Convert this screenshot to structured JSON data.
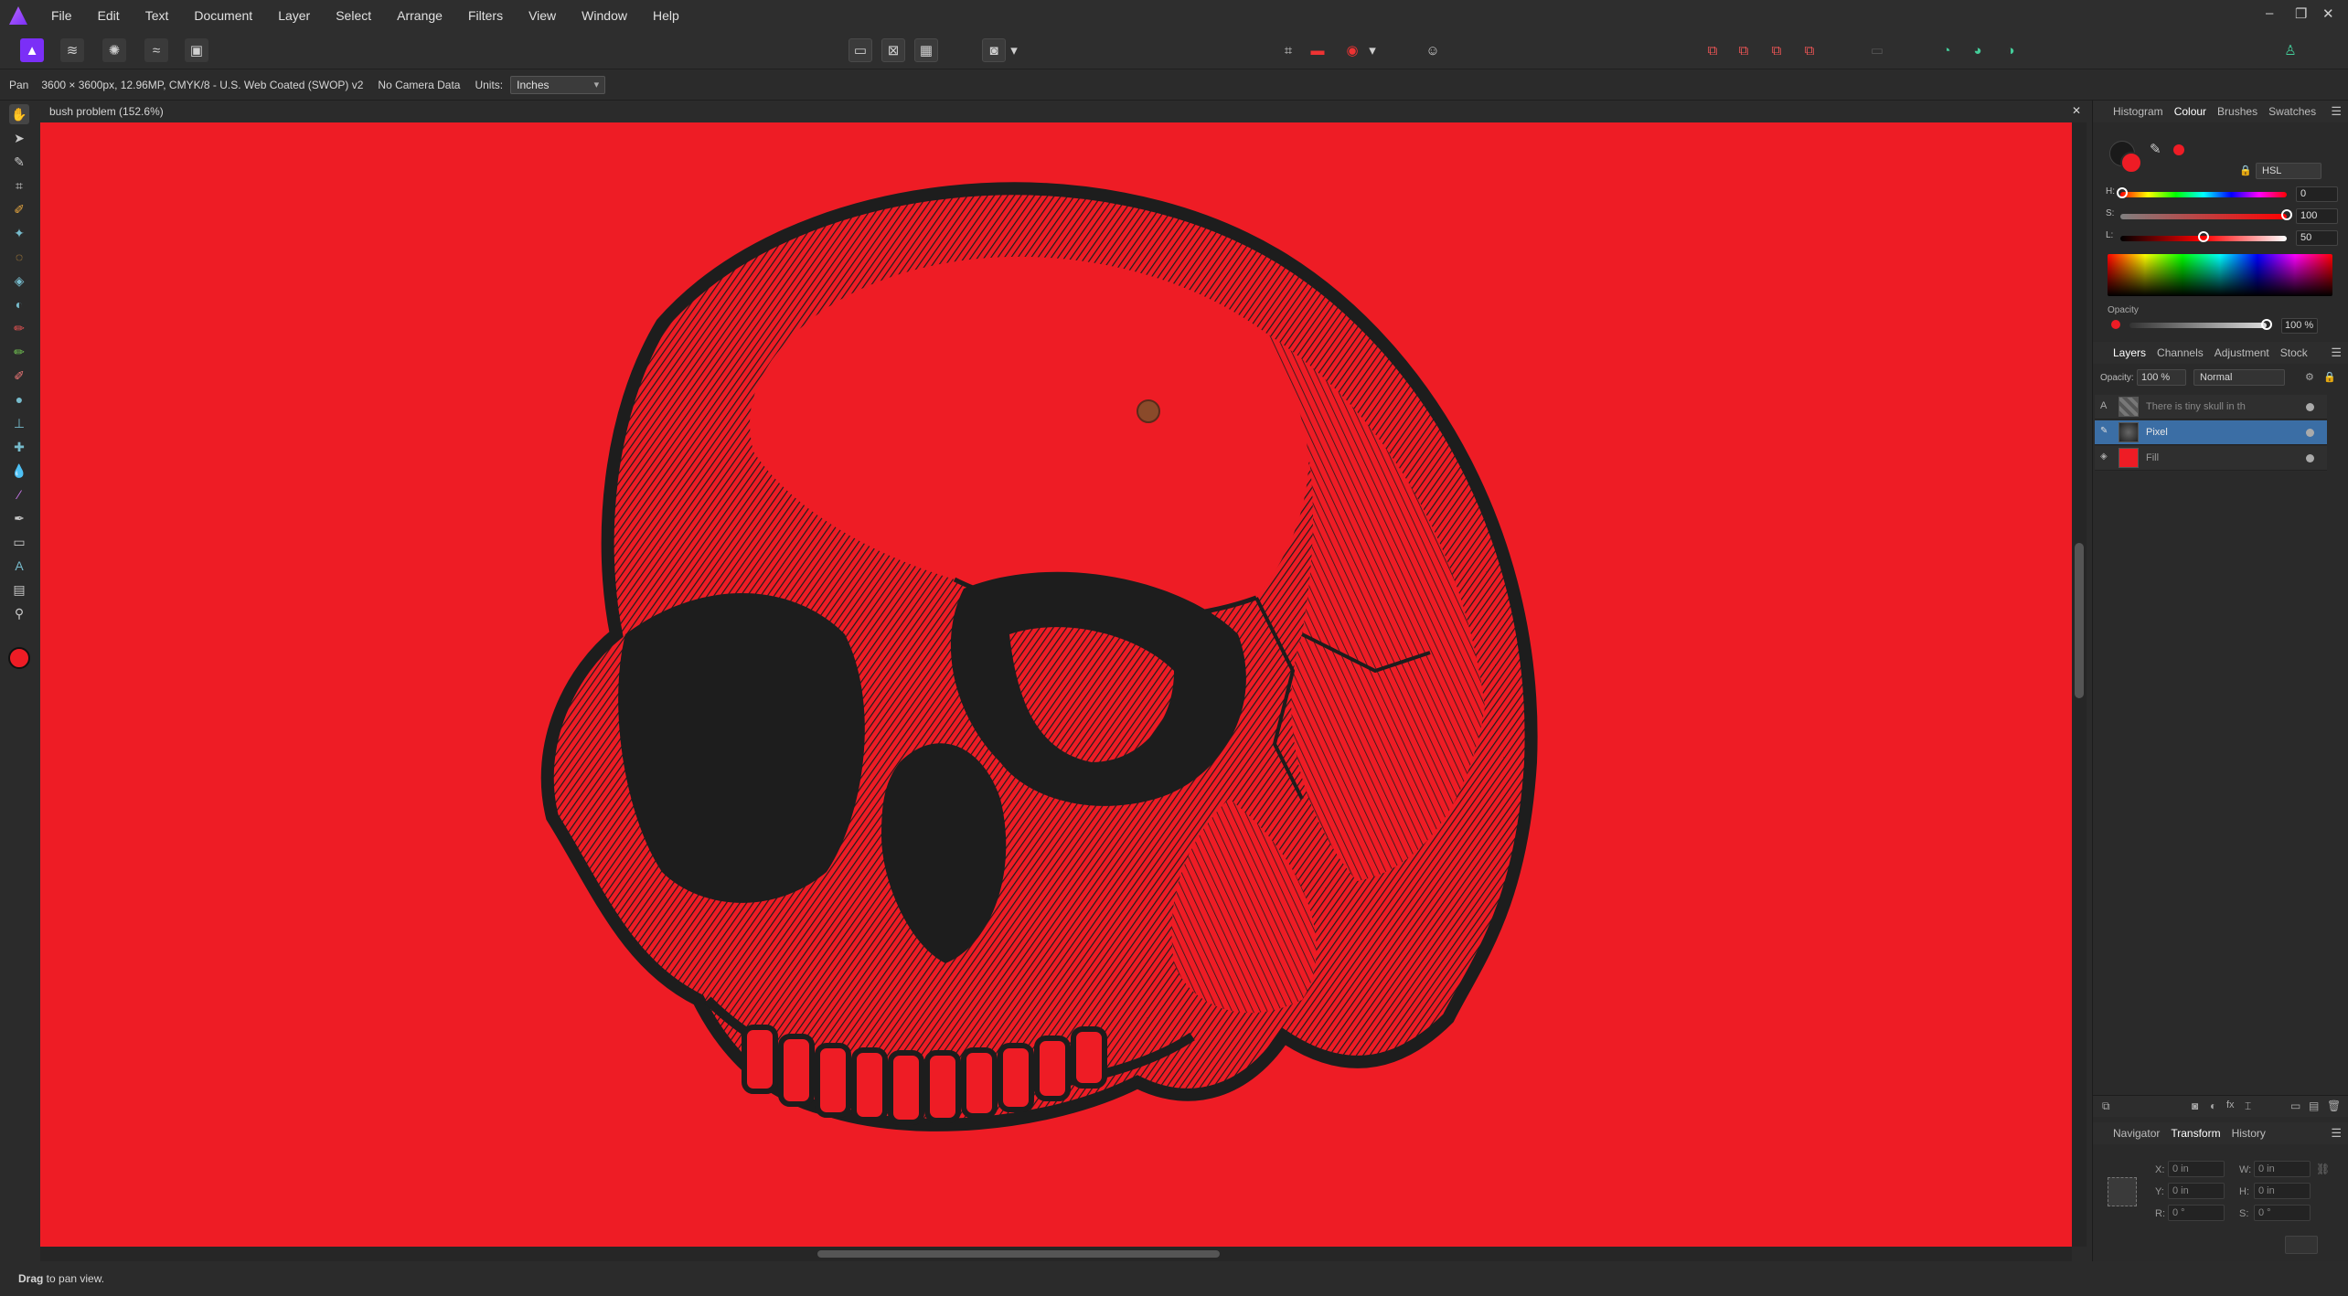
{
  "menubar": {
    "items": [
      "File",
      "Edit",
      "Text",
      "Document",
      "Layer",
      "Select",
      "Arrange",
      "Filters",
      "View",
      "Window",
      "Help"
    ],
    "window_controls": [
      "–",
      "❐",
      "✕"
    ]
  },
  "context": {
    "tool_name": "Pan",
    "doc_info": "3600 × 3600px, 12.96MP, CMYK/8 - U.S. Web Coated (SWOP) v2",
    "camera": "No Camera Data",
    "units_label": "Units:",
    "units_value": "Inches"
  },
  "document": {
    "tab_title": "bush problem (152.6%)",
    "close_glyph": "✕",
    "background_color": "#ee1c25"
  },
  "status": {
    "bold": "Drag",
    "text": " to pan view."
  },
  "colour_panel": {
    "tabs": [
      "Histogram",
      "Colour",
      "Brushes",
      "Swatches"
    ],
    "active_tab": "Colour",
    "mode": "HSL",
    "h_label": "H:",
    "s_label": "S:",
    "l_label": "L:",
    "h_value": "0",
    "s_value": "100",
    "l_value": "50",
    "opacity_label": "Opacity",
    "opacity_value": "100 %",
    "current_color": "#ee1c25"
  },
  "layers_panel": {
    "tabs": [
      "Layers",
      "Channels",
      "Adjustment",
      "Stock"
    ],
    "active_tab": "Layers",
    "opacity_label": "Opacity:",
    "opacity_value": "100 %",
    "blend_mode": "Normal",
    "layers": [
      {
        "name": "There is tiny skull in th",
        "type": "A",
        "selected": false
      },
      {
        "name": "Pixel",
        "type": "",
        "selected": true
      },
      {
        "name": "Fill",
        "type": "",
        "selected": false
      }
    ]
  },
  "transform_panel": {
    "tabs": [
      "Navigator",
      "Transform",
      "History"
    ],
    "active_tab": "Transform",
    "x_label": "X:",
    "x_value": "0 in",
    "y_label": "Y:",
    "y_value": "0 in",
    "w_label": "W:",
    "w_value": "0 in",
    "h_label": "H:",
    "h_value": "0 in",
    "r_label": "R:",
    "r_value": "0 °",
    "s_label": "S:",
    "s_value": "0 °"
  }
}
